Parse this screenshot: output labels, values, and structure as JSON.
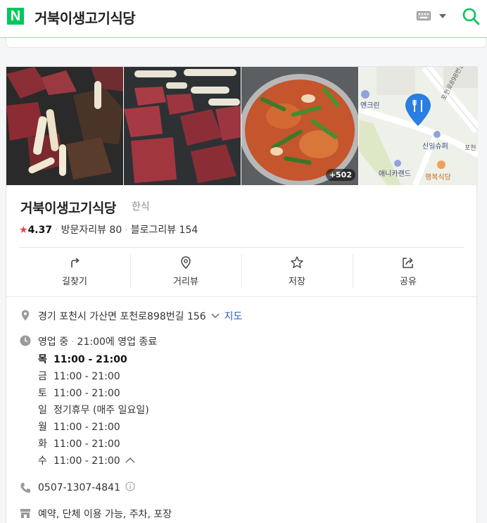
{
  "header": {
    "logo": "N",
    "title": "거북이생고기식당"
  },
  "photos": {
    "more_count": "+502",
    "map": {
      "labels": [
        "엔크린",
        "신일슈퍼",
        "애니카랜드",
        "행복식당",
        "포천로898번길",
        "포천"
      ]
    }
  },
  "place": {
    "name": "거북이생고기식당",
    "category": "한식",
    "rating": "4.37",
    "visitor_reviews": "방문자리뷰 80",
    "blog_reviews": "블로그리뷰 154"
  },
  "actions": [
    {
      "label": "길찾기",
      "icon": "directions-icon"
    },
    {
      "label": "거리뷰",
      "icon": "location-pin-icon"
    },
    {
      "label": "저장",
      "icon": "star-icon"
    },
    {
      "label": "공유",
      "icon": "share-icon"
    }
  ],
  "info": {
    "address": "경기 포천시 가산면 포천로898번길 156",
    "map_link": "지도",
    "status": "영업 중",
    "close_time": "21:00에 영업 종료",
    "hours": [
      {
        "day": "목",
        "time": "11:00 - 21:00"
      },
      {
        "day": "금",
        "time": "11:00 - 21:00"
      },
      {
        "day": "토",
        "time": "11:00 - 21:00"
      },
      {
        "day": "일",
        "time": "정기휴무 (매주 일요일)"
      },
      {
        "day": "월",
        "time": "11:00 - 21:00"
      },
      {
        "day": "화",
        "time": "11:00 - 21:00"
      },
      {
        "day": "수",
        "time": "11:00 - 21:00"
      }
    ],
    "phone": "0507-1307-4841",
    "amenities": "예약, 단체 이용 가능, 주차, 포장"
  },
  "colors": {
    "brand": "#03c75a",
    "star": "#e3473b",
    "link": "#2e5cb8",
    "pin": "#2a7de1"
  }
}
